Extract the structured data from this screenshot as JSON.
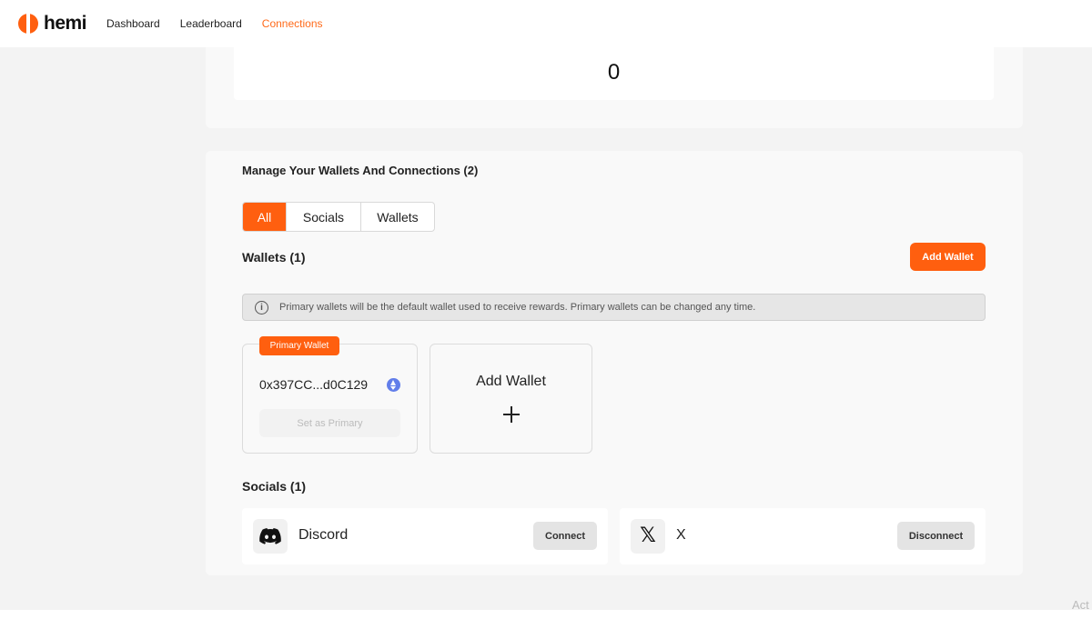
{
  "header": {
    "logo_text": "hemi",
    "nav": [
      {
        "label": "Dashboard",
        "active": false
      },
      {
        "label": "Leaderboard",
        "active": false
      },
      {
        "label": "Connections",
        "active": true
      }
    ],
    "accent_color": "#ff5f0f"
  },
  "stat": {
    "value": "0"
  },
  "manage": {
    "title": "Manage Your Wallets And Connections (2)",
    "tabs": [
      {
        "label": "All",
        "active": true
      },
      {
        "label": "Socials",
        "active": false
      },
      {
        "label": "Wallets",
        "active": false
      }
    ]
  },
  "wallets": {
    "title": "Wallets (1)",
    "add_button": "Add Wallet",
    "notice": "Primary wallets will be the default wallet used to receive rewards. Primary wallets can be changed any time.",
    "items": [
      {
        "badge": "Primary Wallet",
        "address": "0x397CC...d0C129",
        "chain_icon": "ethereum-icon",
        "action": "Set as Primary"
      }
    ],
    "add_card_label": "Add Wallet"
  },
  "socials": {
    "title": "Socials (1)",
    "items": [
      {
        "name": "Discord",
        "icon": "discord-icon",
        "action": "Connect"
      },
      {
        "name": "X",
        "icon": "x-icon",
        "action": "Disconnect"
      }
    ]
  },
  "watermark": "Act"
}
